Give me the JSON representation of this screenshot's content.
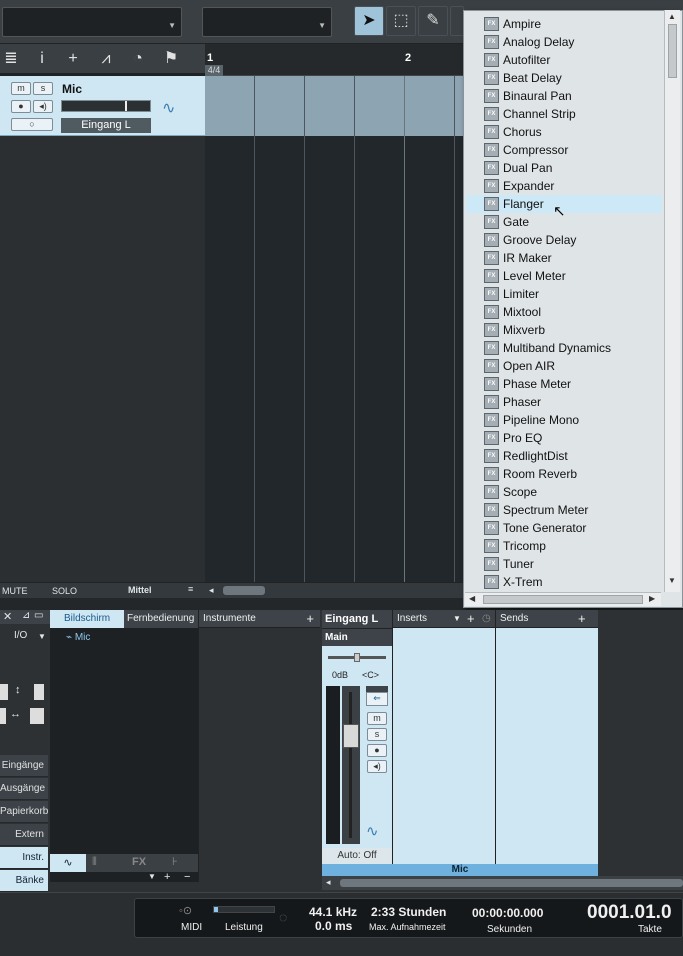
{
  "toolbar": {
    "combo1": "",
    "combo2": ""
  },
  "ruler": {
    "bar1": "1",
    "bar2": "2",
    "timesig": "4/4"
  },
  "track": {
    "name": "Mic",
    "mute_label": "m",
    "solo_label": "s",
    "input": "Eingang L"
  },
  "arrange_footer": {
    "mute": "MUTE",
    "solo": "SOLO",
    "view": "Mittel"
  },
  "fx_menu": {
    "items": [
      "Ampire",
      "Analog Delay",
      "Autofilter",
      "Beat Delay",
      "Binaural Pan",
      "Channel Strip",
      "Chorus",
      "Compressor",
      "Dual Pan",
      "Expander",
      "Flanger",
      "Gate",
      "Groove Delay",
      "IR Maker",
      "Level Meter",
      "Limiter",
      "Mixtool",
      "Mixverb",
      "Multiband Dynamics",
      "Open AIR",
      "Phase Meter",
      "Phaser",
      "Pipeline Mono",
      "Pro EQ",
      "RedlightDist",
      "Room Reverb",
      "Scope",
      "Spectrum Meter",
      "Tone Generator",
      "Tricomp",
      "Tuner",
      "X-Trem"
    ],
    "highlighted": "Flanger",
    "badge": "FX"
  },
  "lower": {
    "io_label": "I/O",
    "tabs": {
      "screen": "Bildschirm",
      "remote": "Fernbedienung",
      "instruments": "Instrumente"
    },
    "track_list": [
      "Mic"
    ],
    "left_buttons": [
      "Eingänge",
      "Ausgänge",
      "Papierkorb",
      "Extern",
      "Instr.",
      "Bänke"
    ],
    "left_active": [
      "Instr.",
      "Bänke"
    ],
    "bottom_tabs": [
      "FX"
    ],
    "channel": {
      "input": "Eingang L",
      "output": "Main",
      "gain": "0dB",
      "pan": "<C>",
      "auto": "Auto: Off",
      "name": "Mic",
      "mute": "m",
      "solo": "s"
    },
    "inserts_label": "Inserts",
    "sends_label": "Sends"
  },
  "transport": {
    "midi": "MIDI",
    "leistung": "Leistung",
    "samplerate": "44.1 kHz",
    "latency": "0.0 ms",
    "rec_time": "2:33 Stunden",
    "rec_label": "Max. Aufnahmezeit",
    "seconds": "00:00:00.000",
    "seconds_label": "Sekunden",
    "bars": "0001.01.0",
    "bars_label": "Takte"
  }
}
